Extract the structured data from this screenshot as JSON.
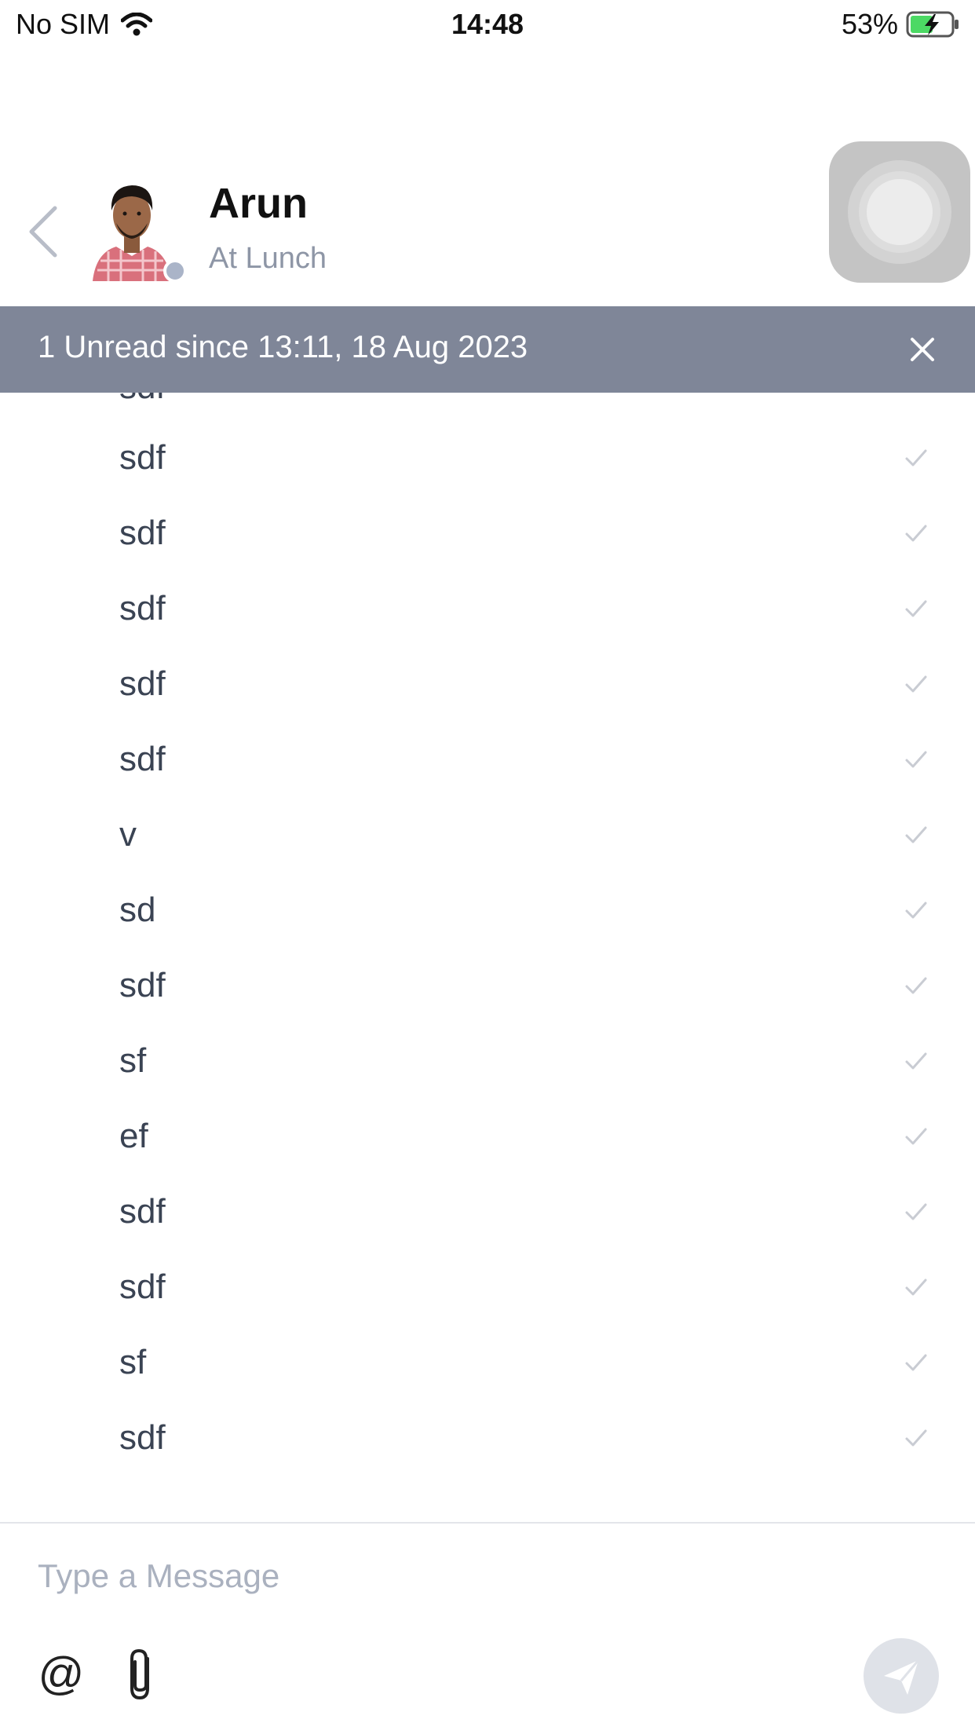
{
  "status_bar": {
    "carrier": "No SIM",
    "time": "14:48",
    "battery": "53%"
  },
  "header": {
    "contact_name": "Arun",
    "contact_status": "At Lunch"
  },
  "unread_banner": {
    "text": "1 Unread since 13:11, 18 Aug 2023"
  },
  "messages": {
    "partial_top": "sdf",
    "items": [
      {
        "text": "sdf"
      },
      {
        "text": "sdf"
      },
      {
        "text": "sdf"
      },
      {
        "text": "sdf"
      },
      {
        "text": "sdf"
      },
      {
        "text": "v"
      },
      {
        "text": "sd"
      },
      {
        "text": "sdf"
      },
      {
        "text": "sf"
      },
      {
        "text": "ef"
      },
      {
        "text": "sdf"
      },
      {
        "text": "sdf"
      },
      {
        "text": "sf"
      },
      {
        "text": "sdf"
      }
    ]
  },
  "composer": {
    "placeholder": "Type a Message",
    "mention_symbol": "@"
  },
  "colors": {
    "banner_bg": "#7f8698",
    "message_text": "#3a4353",
    "status_dot": "#aab4c8",
    "check": "#c9ccd3"
  },
  "icons": {
    "back": "chevron-left-icon",
    "close": "close-icon",
    "read_receipt": "check-icon",
    "attach": "paperclip-icon",
    "send": "send-icon"
  }
}
